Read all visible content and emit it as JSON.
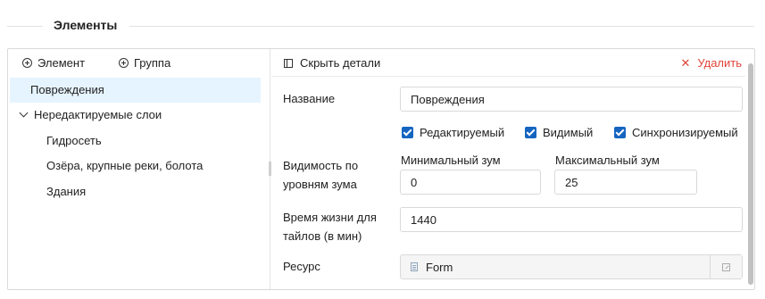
{
  "section": {
    "title": "Элементы"
  },
  "toolbar": {
    "add_element": "Элемент",
    "add_group": "Группа"
  },
  "tree": {
    "selected": "Повреждения",
    "group": "Нередактируемые слои",
    "children": [
      "Гидросеть",
      "Озёра, крупные реки, болота",
      "Здания"
    ]
  },
  "details": {
    "hide_label": "Скрыть детали",
    "delete_label": "Удалить",
    "name_label": "Название",
    "name_value": "Повреждения",
    "checkboxes": [
      "Редактируемый",
      "Видимый",
      "Синхронизируемый"
    ],
    "zoom_label_line1": "Видимость по",
    "zoom_label_line2": "уровням зума",
    "min_zoom_label": "Минимальный зум",
    "min_zoom_value": "0",
    "max_zoom_label": "Максимальный зум",
    "max_zoom_value": "25",
    "ttl_label_line1": "Время жизни для",
    "ttl_label_line2": "тайлов (в мин)",
    "ttl_value": "1440",
    "resource_label": "Ресурс",
    "resource_value": "Form"
  },
  "colors": {
    "accent": "#1565c0",
    "danger": "#e0453a",
    "selected_bg": "#e6f4ff"
  },
  "icons": {
    "add_element": "plus-circle-icon",
    "add_group": "plus-circle-icon",
    "hide": "panel-icon",
    "delete": "close-icon",
    "resource": "file-icon",
    "open": "open-external-icon"
  }
}
